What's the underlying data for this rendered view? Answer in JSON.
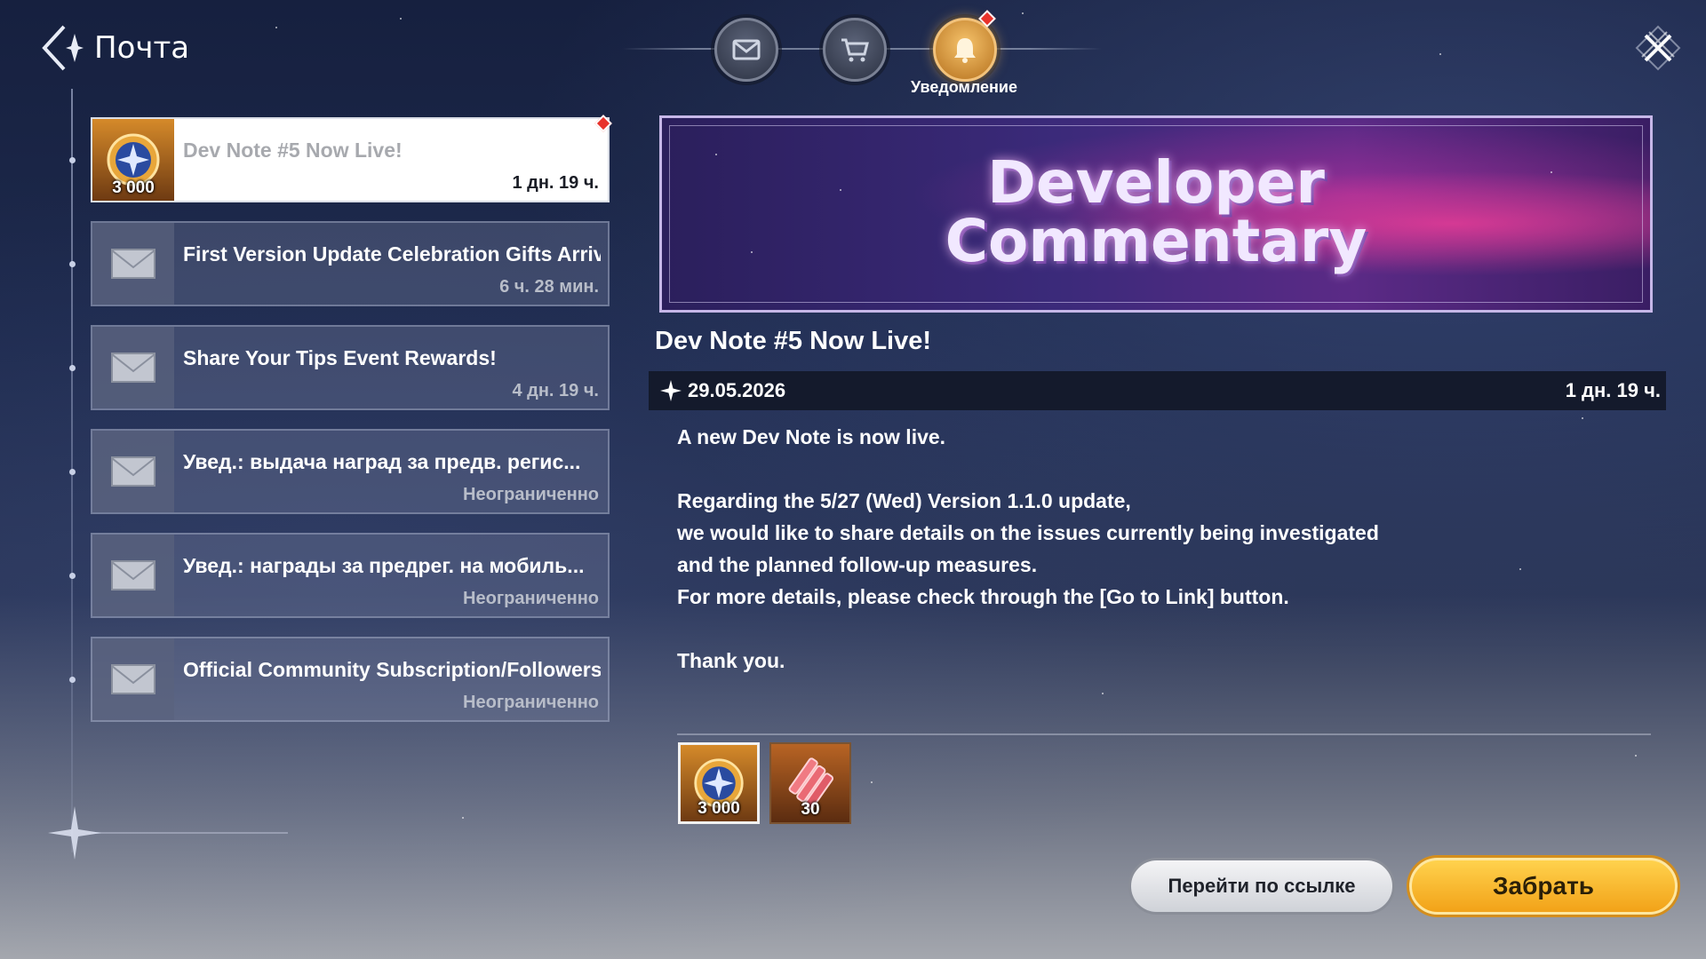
{
  "header": {
    "title": "Почта"
  },
  "tabs": [
    {
      "name": "mail",
      "icon": "envelope-icon",
      "active": false
    },
    {
      "name": "shop",
      "icon": "cart-icon",
      "active": false
    },
    {
      "name": "notification",
      "icon": "bell-icon",
      "active": true,
      "label": "Уведомление"
    }
  ],
  "mail_list": [
    {
      "title": "Dev Note #5 Now Live!",
      "time": "1 дн. 19 ч.",
      "icon": "medal-icon",
      "count": "3 000",
      "selected": true
    },
    {
      "title": "First Version Update Celebration Gifts Arrive!",
      "time": "6 ч. 28 мин.",
      "icon": "envelope-icon",
      "selected": false
    },
    {
      "title": "Share Your Tips Event Rewards!",
      "time": "4 дн. 19 ч.",
      "icon": "envelope-icon",
      "selected": false
    },
    {
      "title": "Увед.: выдача наград за предв. регис...",
      "time": "Неограниченно",
      "icon": "envelope-icon",
      "selected": false
    },
    {
      "title": "Увед.: награды за предрег. на мобиль...",
      "time": "Неограниченно",
      "icon": "envelope-icon",
      "selected": false
    },
    {
      "title": "Official Community Subscription/Followers...",
      "time": "Неограниченно",
      "icon": "envelope-icon",
      "selected": false
    }
  ],
  "detail": {
    "banner_line1": "Developer",
    "banner_line2": "Commentary",
    "title": "Dev Note #5 Now Live!",
    "date": "29.05.2026",
    "remaining": "1 дн. 19 ч.",
    "body": [
      "A new Dev Note is now live.",
      "",
      "Regarding the 5/27 (Wed) Version 1.1.0 update,",
      "we would like to share details on the issues currently being investigated",
      "and the planned follow-up measures.",
      "For more details, please check through the [Go to Link] button.",
      "",
      "Thank you."
    ],
    "rewards": [
      {
        "icon": "medal-icon",
        "count": "3 000"
      },
      {
        "icon": "tickets-icon",
        "count": "30"
      }
    ]
  },
  "buttons": {
    "go_to_link": "Перейти по ссылке",
    "claim": "Забрать"
  },
  "colors": {
    "accent_gold": "#f2a218",
    "notification_red": "#e8322b",
    "selected_item_bg": "#ffffff"
  }
}
